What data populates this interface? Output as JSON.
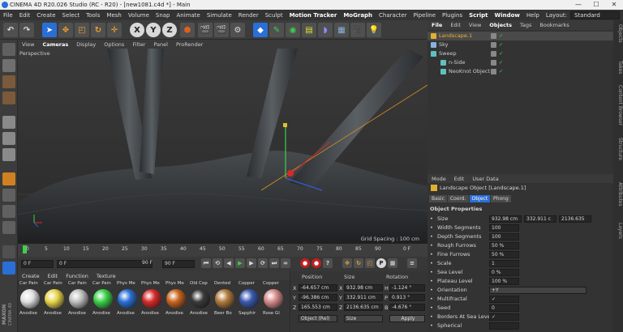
{
  "window": {
    "title": "CINEMA 4D R20.026 Studio (RC - R20) - [new1081.c4d *] - Main",
    "minimize": "—",
    "maximize": "☐",
    "close": "✕"
  },
  "menubar": {
    "items": [
      "File",
      "Edit",
      "Create",
      "Select",
      "Tools",
      "Mesh",
      "Volume",
      "Snap",
      "Animate",
      "Simulate",
      "Render",
      "Sculpt",
      "Motion Tracker",
      "MoGraph",
      "Character",
      "Pipeline",
      "Plugins",
      "Script",
      "Window",
      "Help"
    ],
    "layout_label": "Layout:",
    "layout_value": "Standard"
  },
  "toolbar": {
    "axis_x": "X",
    "axis_y": "Y",
    "axis_z": "Z"
  },
  "viewport": {
    "menu": [
      "View",
      "Cameras",
      "Display",
      "Options",
      "Filter",
      "Panel",
      "ProRender"
    ],
    "camera_label": "Perspective",
    "grid_spacing": "Grid Spacing : 100 cm"
  },
  "timeline": {
    "ticks": [
      "0",
      "5",
      "10",
      "15",
      "20",
      "25",
      "30",
      "35",
      "40",
      "45",
      "50",
      "55",
      "60",
      "65",
      "70",
      "75",
      "80",
      "85",
      "90"
    ],
    "frame_end": "0 F"
  },
  "playback": {
    "start_frame": "0 F",
    "current_frame": "0 F",
    "end_frame": "90 F",
    "end_frame2": "90 F"
  },
  "materials": {
    "menu": [
      "Create",
      "Edit",
      "Function",
      "Texture"
    ],
    "items": [
      {
        "top": "Car Pain",
        "bottom": "Anodise",
        "color": "#e0e0e0"
      },
      {
        "top": "Car Pain",
        "bottom": "Anodise",
        "color": "#e8d54a"
      },
      {
        "top": "Car Pain",
        "bottom": "Anodise",
        "color": "#c0c0c0"
      },
      {
        "top": "Car Pain",
        "bottom": "Anodise",
        "color": "#3bd14a"
      },
      {
        "top": "Phys Me",
        "bottom": "Anodise",
        "color": "#2a6fd6"
      },
      {
        "top": "Phys Me",
        "bottom": "Anodise",
        "color": "#d62a2a"
      },
      {
        "top": "Phys Me",
        "bottom": "Anodise",
        "color": "#c8641e"
      },
      {
        "top": "Old Cop",
        "bottom": "Anodise",
        "color": "#3a3a3a"
      },
      {
        "top": "Dented",
        "bottom": "Beer Bo",
        "color": "#b07a3a"
      },
      {
        "top": "Copper",
        "bottom": "Sapphir",
        "color": "#3a5ab0"
      },
      {
        "top": "Copper",
        "bottom": "Rose Gl",
        "color": "#d88a8a"
      }
    ]
  },
  "coordinates": {
    "header_position": "Position",
    "header_size": "Size",
    "header_rotation": "Rotation",
    "rows": [
      {
        "axis": "X",
        "pos": "-64.657 cm",
        "size": "932.98 cm",
        "rlabel": "H",
        "rot": "-1.124 °"
      },
      {
        "axis": "Y",
        "pos": "-96.386 cm",
        "size": "332.911 cm",
        "rlabel": "P",
        "rot": "0.913 °"
      },
      {
        "axis": "Z",
        "pos": "165.553 cm",
        "size": "2136.635 cm",
        "rlabel": "B",
        "rot": "-4.676 °"
      }
    ],
    "mode_dropdown": "Object (Rel)",
    "size_dropdown": "Size",
    "apply": "Apply"
  },
  "objects": {
    "tabs": [
      "File",
      "Edit",
      "View",
      "Objects",
      "Tags",
      "Bookmarks"
    ],
    "rows": [
      {
        "name": "Landscape.1",
        "indent": 0,
        "selected": true,
        "color": "#e0b030"
      },
      {
        "name": "Sky",
        "indent": 0,
        "selected": false,
        "color": "#8ab0e0"
      },
      {
        "name": "Sweep",
        "indent": 0,
        "selected": false,
        "color": "#60c0c0"
      },
      {
        "name": "n-Side",
        "indent": 1,
        "selected": false,
        "color": "#60c0c0"
      },
      {
        "name": "NeoKnot Object",
        "indent": 1,
        "selected": false,
        "color": "#60c0c0"
      }
    ]
  },
  "attributes": {
    "tabs": [
      "Mode",
      "Edit",
      "User Data"
    ],
    "object_title": "Landscape Object [Landscape.1]",
    "subtabs": [
      "Basic",
      "Coord.",
      "Object",
      "Phong"
    ],
    "section": "Object Properties",
    "size_label": "Size",
    "size_values": [
      "932.98 cm",
      "332.911 c",
      "2136.635"
    ],
    "props": [
      {
        "label": "Width Segments",
        "value": "100"
      },
      {
        "label": "Depth Segments",
        "value": "100"
      },
      {
        "label": "Rough Furrows",
        "value": "50 %"
      },
      {
        "label": "Fine Furrows",
        "value": "50 %"
      },
      {
        "label": "Scale",
        "value": "1"
      },
      {
        "label": "Sea Level",
        "value": "0 %"
      },
      {
        "label": "Plateau Level",
        "value": "100 %"
      },
      {
        "label": "Orientation",
        "value": "+Y"
      },
      {
        "label": "Multifractal",
        "value": "✓"
      },
      {
        "label": "Seed",
        "value": "0"
      },
      {
        "label": "Borders At Sea Level",
        "value": "✓"
      },
      {
        "label": "Spherical",
        "value": ""
      }
    ]
  },
  "side_tabs": [
    "Objects",
    "Takes",
    "Content Browser",
    "Structure",
    "Attributes",
    "Layers"
  ],
  "brand": {
    "line1": "MAXON",
    "line2": "CINEMA 4D"
  }
}
